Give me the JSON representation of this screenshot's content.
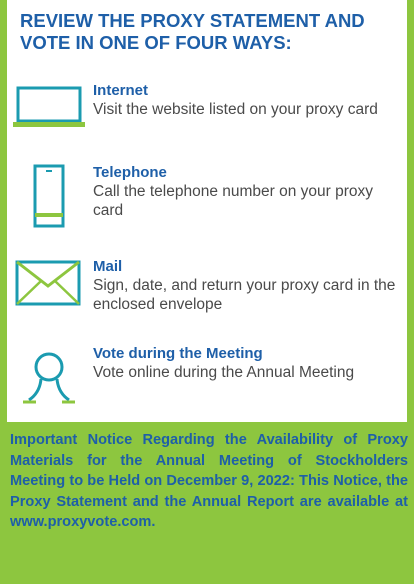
{
  "title": "REVIEW THE PROXY STATEMENT AND VOTE IN ONE OF FOUR WAYS:",
  "methods": [
    {
      "label": "Internet",
      "description": "Visit the website listed on your proxy card",
      "icon": "laptop-icon"
    },
    {
      "label": "Telephone",
      "description": "Call the telephone number on  your proxy card",
      "icon": "phone-icon"
    },
    {
      "label": "Mail",
      "description": "Sign, date, and return your proxy card in the enclosed envelope",
      "icon": "envelope-icon"
    },
    {
      "label": "Vote during the Meeting",
      "description": "Vote online during the Annual Meeting",
      "icon": "person-icon"
    }
  ],
  "notice": "Important Notice Regarding the Availability of Proxy Materials for the Annual Meeting of Stockholders Meeting to be Held on December 9, 2022: This Notice, the Proxy Statement and the Annual Report are available at www.proxyvote.com.",
  "colors": {
    "accent_green": "#8dc63f",
    "heading_blue": "#1e5fa8",
    "icon_teal": "#1b9bb0",
    "body_gray": "#4a4a4a"
  }
}
